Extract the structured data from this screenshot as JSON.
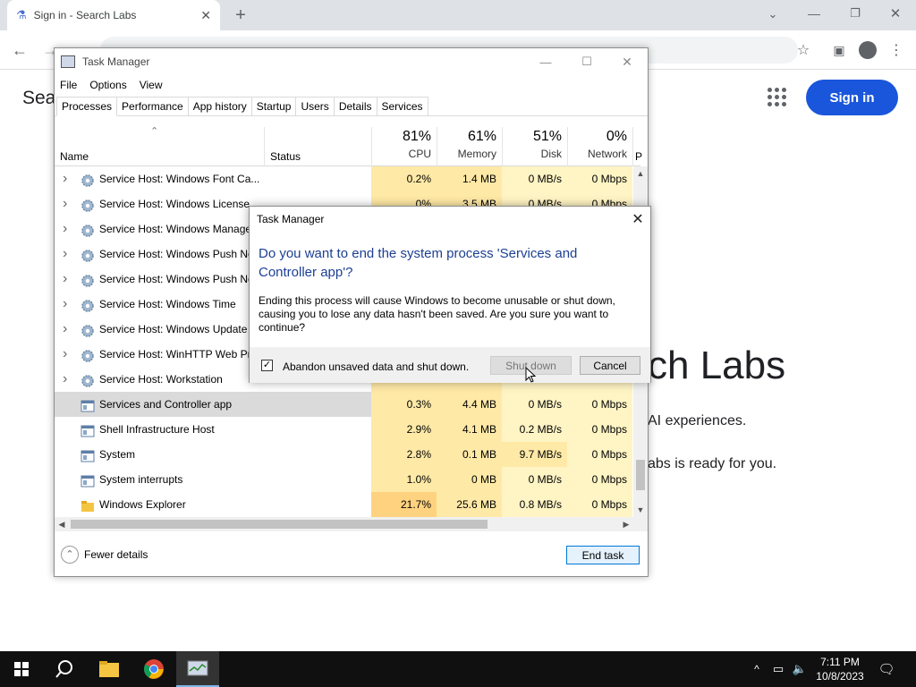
{
  "browser": {
    "tab_title": "Sign in - Search Labs",
    "new_tab_symbol": "+",
    "page_partial_title": "Sea",
    "sign_in_label": "Sign in",
    "hero_text": "ch Labs",
    "hero_line1": "AI experiences.",
    "hero_line2": "abs is ready for you."
  },
  "task_manager": {
    "title": "Task Manager",
    "menu": [
      "File",
      "Options",
      "View"
    ],
    "tabs": [
      "Processes",
      "Performance",
      "App history",
      "Startup",
      "Users",
      "Details",
      "Services"
    ],
    "columns": {
      "name": "Name",
      "status": "Status",
      "cpu_pct": "81%",
      "cpu": "CPU",
      "memory_pct": "61%",
      "memory": "Memory",
      "disk_pct": "51%",
      "disk": "Disk",
      "network_pct": "0%",
      "network": "Network",
      "power": "P"
    },
    "rows": [
      {
        "name": "Service Host: Windows Font Ca...",
        "cpu": "0.2%",
        "mem": "1.4 MB",
        "disk": "0 MB/s",
        "net": "0 Mbps",
        "expand": true
      },
      {
        "name": "Service Host: Windows License ...",
        "cpu": "0%",
        "mem": "3.5 MB",
        "disk": "0 MB/s",
        "net": "0 Mbps",
        "expand": true
      },
      {
        "name": "Service Host: Windows Manage...",
        "cpu": "",
        "mem": "",
        "disk": "",
        "net": "",
        "expand": true
      },
      {
        "name": "Service Host: Windows Push No...",
        "cpu": "",
        "mem": "",
        "disk": "",
        "net": "",
        "expand": true
      },
      {
        "name": "Service Host: Windows Push No...",
        "cpu": "",
        "mem": "",
        "disk": "",
        "net": "",
        "expand": true
      },
      {
        "name": "Service Host: Windows Time",
        "cpu": "",
        "mem": "",
        "disk": "",
        "net": "",
        "expand": true
      },
      {
        "name": "Service Host: Windows Update",
        "cpu": "",
        "mem": "",
        "disk": "",
        "net": "",
        "expand": true
      },
      {
        "name": "Service Host: WinHTTP Web Pro...",
        "cpu": "",
        "mem": "",
        "disk": "",
        "net": "",
        "expand": true
      },
      {
        "name": "Service Host: Workstation",
        "cpu": "",
        "mem": "",
        "disk": "",
        "net": "",
        "expand": true
      },
      {
        "name": "Services and Controller app",
        "cpu": "0.3%",
        "mem": "4.4 MB",
        "disk": "0 MB/s",
        "net": "0 Mbps",
        "expand": false,
        "selected": true
      },
      {
        "name": "Shell Infrastructure Host",
        "cpu": "2.9%",
        "mem": "4.1 MB",
        "disk": "0.2 MB/s",
        "net": "0 Mbps",
        "expand": false
      },
      {
        "name": "System",
        "cpu": "2.8%",
        "mem": "0.1 MB",
        "disk": "9.7 MB/s",
        "net": "0 Mbps",
        "expand": false
      },
      {
        "name": "System interrupts",
        "cpu": "1.0%",
        "mem": "0 MB",
        "disk": "0 MB/s",
        "net": "0 Mbps",
        "expand": false
      },
      {
        "name": "Windows Explorer",
        "cpu": "21.7%",
        "mem": "25.6 MB",
        "disk": "0.8 MB/s",
        "net": "0 Mbps",
        "expand": false
      }
    ],
    "fewer_details": "Fewer details",
    "end_task": "End task"
  },
  "dialog": {
    "title": "Task Manager",
    "heading": "Do you want to end the system process 'Services and Controller app'?",
    "body": "Ending this process will cause Windows to become unusable or shut down, causing you to lose any data hasn't been saved. Are you sure you want to continue?",
    "checkbox_label": "Abandon unsaved data and shut down.",
    "checkbox_checked": true,
    "checkbox_mark": "✓",
    "shutdown_label": "Shut down",
    "cancel_label": "Cancel"
  },
  "taskbar": {
    "time": "7:11 PM",
    "date": "10/8/2023"
  },
  "colors": {
    "accent": "#1a56db",
    "heat_light": "#fff4c4",
    "heat_mid": "#ffe9a6",
    "heat_strong": "#ffd27f",
    "selected_row": "#dadada"
  }
}
